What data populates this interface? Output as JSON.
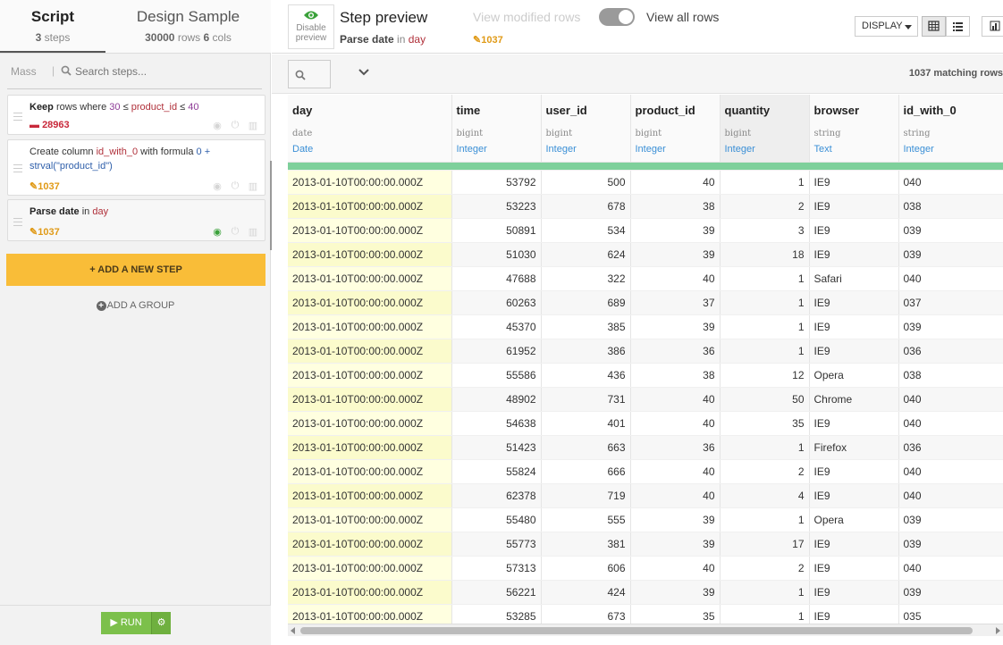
{
  "tabs": {
    "script": {
      "title": "Script",
      "count": "3",
      "unit": "steps"
    },
    "design": {
      "title": "Design Sample",
      "rows": "30000",
      "rows_unit": "rows",
      "cols": "6",
      "cols_unit": "cols"
    }
  },
  "search": {
    "mass_label": "Mass",
    "placeholder": "Search steps..."
  },
  "steps": [
    {
      "verb": "Keep",
      "text_a": "rows where",
      "v1": "30",
      "op1": "≤",
      "col": "product_id",
      "op2": "≤",
      "v2": "40",
      "badge": "28963"
    },
    {
      "text_a": "Create column",
      "col": "id_with_0",
      "text_b": "with formula",
      "v1": "0",
      "op": "+",
      "fn": "strval(\"product_id\")",
      "badge": "1037"
    },
    {
      "verb": "Parse date",
      "text_a": "in",
      "col": "day",
      "badge": "1037"
    }
  ],
  "buttons": {
    "add_step": "+ ADD A NEW STEP",
    "add_group": "ADD A GROUP",
    "run": "RUN",
    "display": "DISPLAY"
  },
  "preview": {
    "disable_label_1": "Disable",
    "disable_label_2": "preview",
    "title": "Step preview",
    "sub_action": "Parse date",
    "sub_in": "in",
    "sub_col": "day",
    "view_modified": "View modified rows",
    "view_all": "View all rows",
    "count": "1037",
    "matching": "1037 matching rows"
  },
  "colors": {
    "accent_yellow": "#f9bd38",
    "run_green": "#7cc04b",
    "valid_bar": "#7ed09b",
    "step_red": "#c8283a",
    "step_orange": "#e09a17",
    "meaning_blue": "#3a8fd6"
  },
  "table": {
    "columns": [
      {
        "name": "day",
        "type": "date",
        "meaning": "Date"
      },
      {
        "name": "time",
        "type": "bigint",
        "meaning": "Integer"
      },
      {
        "name": "user_id",
        "type": "bigint",
        "meaning": "Integer"
      },
      {
        "name": "product_id",
        "type": "bigint",
        "meaning": "Integer"
      },
      {
        "name": "quantity",
        "type": "bigint",
        "meaning": "Integer"
      },
      {
        "name": "browser",
        "type": "string",
        "meaning": "Text"
      },
      {
        "name": "id_with_0",
        "type": "string",
        "meaning": "Integer"
      }
    ],
    "rows": [
      [
        "2013-01-10T00:00:00.000Z",
        "53792",
        "500",
        "40",
        "1",
        "IE9",
        "040"
      ],
      [
        "2013-01-10T00:00:00.000Z",
        "53223",
        "678",
        "38",
        "2",
        "IE9",
        "038"
      ],
      [
        "2013-01-10T00:00:00.000Z",
        "50891",
        "534",
        "39",
        "3",
        "IE9",
        "039"
      ],
      [
        "2013-01-10T00:00:00.000Z",
        "51030",
        "624",
        "39",
        "18",
        "IE9",
        "039"
      ],
      [
        "2013-01-10T00:00:00.000Z",
        "47688",
        "322",
        "40",
        "1",
        "Safari",
        "040"
      ],
      [
        "2013-01-10T00:00:00.000Z",
        "60263",
        "689",
        "37",
        "1",
        "IE9",
        "037"
      ],
      [
        "2013-01-10T00:00:00.000Z",
        "45370",
        "385",
        "39",
        "1",
        "IE9",
        "039"
      ],
      [
        "2013-01-10T00:00:00.000Z",
        "61952",
        "386",
        "36",
        "1",
        "IE9",
        "036"
      ],
      [
        "2013-01-10T00:00:00.000Z",
        "55586",
        "436",
        "38",
        "12",
        "Opera",
        "038"
      ],
      [
        "2013-01-10T00:00:00.000Z",
        "48902",
        "731",
        "40",
        "50",
        "Chrome",
        "040"
      ],
      [
        "2013-01-10T00:00:00.000Z",
        "54638",
        "401",
        "40",
        "35",
        "IE9",
        "040"
      ],
      [
        "2013-01-10T00:00:00.000Z",
        "51423",
        "663",
        "36",
        "1",
        "Firefox",
        "036"
      ],
      [
        "2013-01-10T00:00:00.000Z",
        "55824",
        "666",
        "40",
        "2",
        "IE9",
        "040"
      ],
      [
        "2013-01-10T00:00:00.000Z",
        "62378",
        "719",
        "40",
        "4",
        "IE9",
        "040"
      ],
      [
        "2013-01-10T00:00:00.000Z",
        "55480",
        "555",
        "39",
        "1",
        "Opera",
        "039"
      ],
      [
        "2013-01-10T00:00:00.000Z",
        "55773",
        "381",
        "39",
        "17",
        "IE9",
        "039"
      ],
      [
        "2013-01-10T00:00:00.000Z",
        "57313",
        "606",
        "40",
        "2",
        "IE9",
        "040"
      ],
      [
        "2013-01-10T00:00:00.000Z",
        "56221",
        "424",
        "39",
        "1",
        "IE9",
        "039"
      ],
      [
        "2013-01-10T00:00:00.000Z",
        "53285",
        "673",
        "35",
        "1",
        "IE9",
        "035"
      ]
    ]
  }
}
